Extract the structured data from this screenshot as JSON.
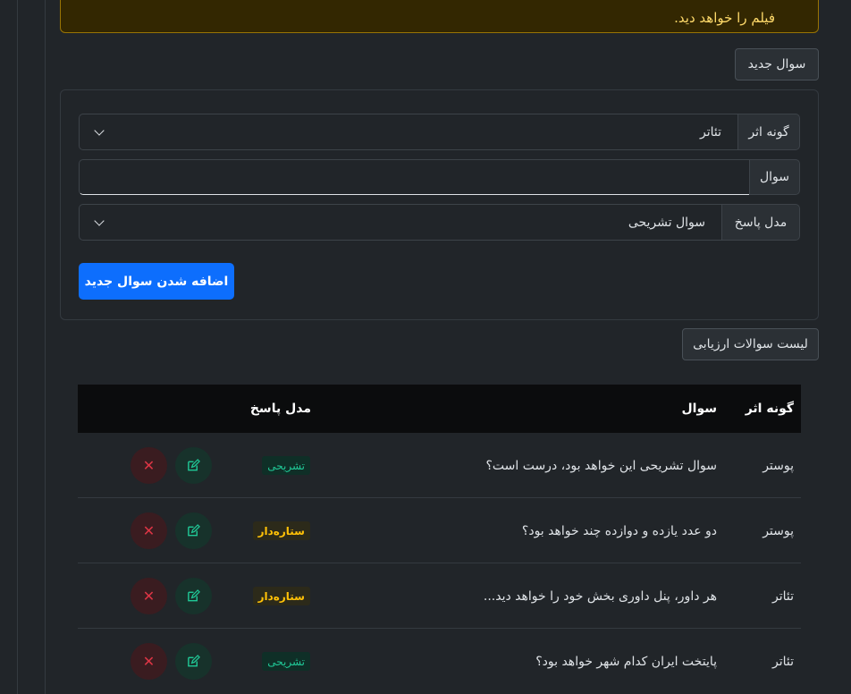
{
  "alert": {
    "text": "فیلم را خواهد دید."
  },
  "new_question": {
    "header_label": "سوال جدید",
    "fields": {
      "work_type": {
        "label": "گونه اثر",
        "value": "تئاتر"
      },
      "question": {
        "label": "سوال",
        "value": ""
      },
      "answer_model": {
        "label": "مدل پاسخ",
        "value": "سوال تشریحی"
      }
    },
    "submit_label": "اضافه شدن سوال جدید"
  },
  "list": {
    "header_label": "لیست سوالات ارزیابی",
    "columns": {
      "work_type": "گونه اثر",
      "question": "سوال",
      "answer_model": "مدل پاسخ"
    },
    "rows": [
      {
        "work_type": "پوستر",
        "question": "سوال تشریحی این خواهد بود، درست است؟",
        "answer_model": "تشریحی"
      },
      {
        "work_type": "پوستر",
        "question": "دو عدد یازده و دوازده چند خواهد بود؟",
        "answer_model": "ستاره‌دار"
      },
      {
        "work_type": "تئاتر",
        "question": "هر داور، پنل داوری بخش خود را خواهد دید...",
        "answer_model": "ستاره‌دار"
      },
      {
        "work_type": "تئاتر",
        "question": "پایتخت ایران کدام شهر خواهد بود؟",
        "answer_model": "تشریحی"
      }
    ]
  },
  "colors": {
    "background": "#212529",
    "primary": "#0d6efd",
    "warning_text": "#ffda6a",
    "success": "#20c997",
    "danger": "#dc3545",
    "star": "#ffc107"
  },
  "icons": {
    "edit": "pencil-square-icon",
    "delete": "x-icon",
    "dropdown": "chevron-down-icon"
  }
}
